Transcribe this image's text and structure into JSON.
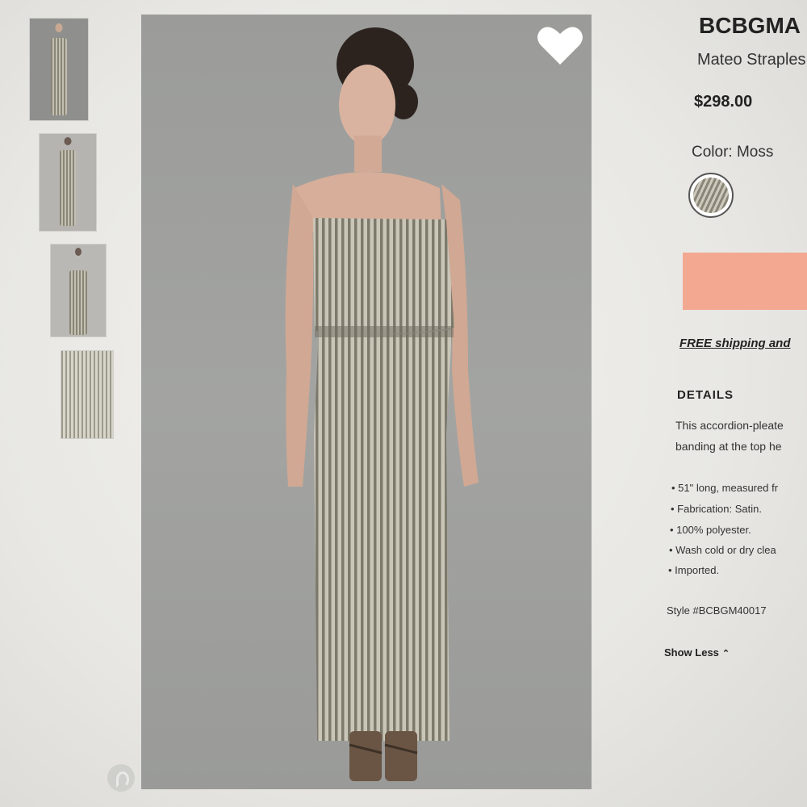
{
  "product": {
    "brand": "BCBGMA",
    "name": "Mateo Straples",
    "price": "$298.00",
    "color_label": "Color: Moss",
    "swatch_icon": "moss-stripe-swatch",
    "add_button_color": "#f3a892"
  },
  "shipping_text": "FREE shipping and",
  "details": {
    "heading": "DETAILS",
    "description_lines": [
      "This accordion-pleate",
      "banding at the top he"
    ],
    "bullets": [
      "51\" long, measured fr",
      "Fabrication: Satin.",
      "100% polyester.",
      "Wash cold or dry clea",
      "Imported."
    ],
    "style": "Style #BCBGM40017",
    "show_less": "Show Less"
  },
  "icons": {
    "favorite": "heart-icon",
    "pinterest": "pinterest-icon",
    "chevron": "chevron-up-icon"
  }
}
